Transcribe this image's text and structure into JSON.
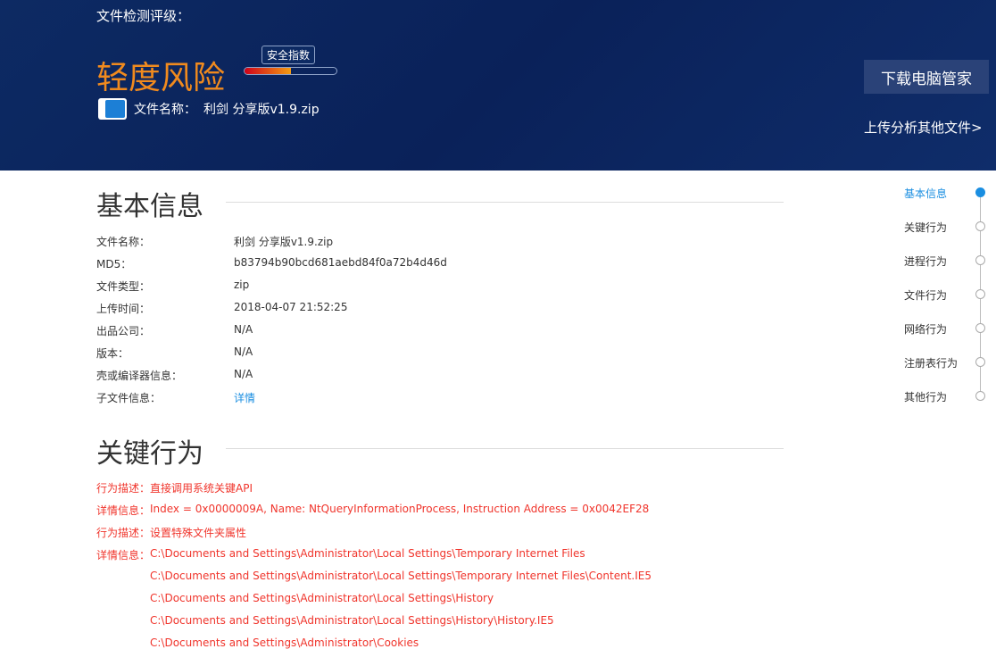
{
  "header": {
    "rating_label": "文件检测评级：",
    "risk_level": "轻度风险",
    "safety_tip": "安全指数",
    "safety_index_percent": 50,
    "file_name_label": "文件名称：",
    "file_name": "利剑 分享版v1.9.zip",
    "download_button": "下载电脑管家",
    "upload_link": "上传分析其他文件>"
  },
  "basic": {
    "title": "基本信息",
    "rows": [
      {
        "label": "文件名称：",
        "value": "利剑 分享版v1.9.zip"
      },
      {
        "label": "MD5：",
        "value": "b83794b90bcd681aebd84f0a72b4d46d"
      },
      {
        "label": "文件类型：",
        "value": "zip"
      },
      {
        "label": "上传时间：",
        "value": "2018-04-07 21:52:25"
      },
      {
        "label": "出品公司：",
        "value": "N/A"
      },
      {
        "label": "版本：",
        "value": "N/A"
      },
      {
        "label": "壳或编译器信息：",
        "value": "N/A"
      },
      {
        "label": "子文件信息：",
        "value": "详情"
      }
    ]
  },
  "key": {
    "title": "关键行为",
    "lines": [
      {
        "label": "行为描述：",
        "value": "直接调用系统关键API"
      },
      {
        "label": "详情信息：",
        "value": "Index = 0x0000009A, Name: NtQueryInformationProcess, Instruction Address = 0x0042EF28"
      },
      {
        "label": "行为描述：",
        "value": "设置特殊文件夹属性"
      },
      {
        "label": "详情信息：",
        "value": "C:\\Documents and Settings\\Administrator\\Local Settings\\Temporary Internet Files"
      },
      {
        "label": "",
        "value": "C:\\Documents and Settings\\Administrator\\Local Settings\\Temporary Internet Files\\Content.IE5"
      },
      {
        "label": "",
        "value": "C:\\Documents and Settings\\Administrator\\Local Settings\\History"
      },
      {
        "label": "",
        "value": "C:\\Documents and Settings\\Administrator\\Local Settings\\History\\History.IE5"
      },
      {
        "label": "",
        "value": "C:\\Documents and Settings\\Administrator\\Cookies"
      }
    ]
  },
  "nav": [
    "基本信息",
    "关键行为",
    "进程行为",
    "文件行为",
    "网络行为",
    "注册表行为",
    "其他行为"
  ]
}
